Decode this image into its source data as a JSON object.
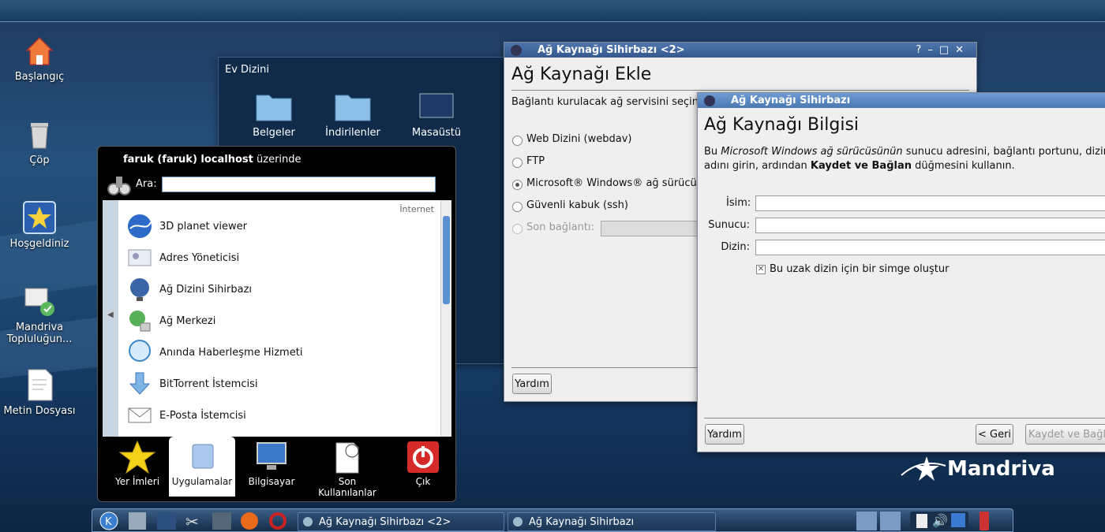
{
  "desktop": {
    "icons": [
      {
        "label": "Başlangıç",
        "icon": "home-icon"
      },
      {
        "label": "Çöp",
        "icon": "trash-icon"
      },
      {
        "label": "Hoşgeldiniz",
        "icon": "star-icon"
      },
      {
        "label": "Mandriva Topluluğun...",
        "icon": "mandriva-community-icon"
      },
      {
        "label": "Metin Dosyası",
        "icon": "text-file-icon"
      }
    ],
    "brand": "Mandriva"
  },
  "filemanager": {
    "title": "Ev Dizini",
    "folders": [
      "Belgeler",
      "İndirilenler",
      "Masaüstü"
    ]
  },
  "wizard1": {
    "title": "Ağ Kaynağı Sihirbazı <2>",
    "heading": "Ağ Kaynağı Ekle",
    "intro": "Bağlantı kurulacak ağ servisini seçin v",
    "options": [
      "Web Dizini (webdav)",
      "FTP",
      "Microsoft® Windows® ağ sürücüs",
      "Güvenli kabuk (ssh)",
      "Son bağlantı:"
    ],
    "selected_index": 2,
    "help": "Yardım"
  },
  "wizard2": {
    "title": "Ağ Kaynağı Sihirbazı",
    "heading": "Ağ Kaynağı Bilgisi",
    "desc_pre": "Bu ",
    "desc_em": "Microsoft Windows ağ sürücüsünün",
    "desc_mid": " sunucu adresini, bağlantı portunu, dizin",
    "desc_line2_pre": "adını girin, ardından ",
    "desc_bold": "Kaydet ve Bağlan",
    "desc_line2_post": " düğmesini kullanın.",
    "fields": [
      {
        "label": "İsim:",
        "value": ""
      },
      {
        "label": "Sunucu:",
        "value": ""
      },
      {
        "label": "Dizin:",
        "value": ""
      }
    ],
    "checkbox": "Bu uzak dizin için bir simge oluştur",
    "checkbox_checked": true,
    "help": "Yardım",
    "back": "< Geri",
    "save": "Kaydet ve Bağla"
  },
  "menu": {
    "user": "faruk (faruk) localhost",
    "user_suffix": " üzerinde",
    "search_label": "Ara:",
    "search_value": "",
    "category": "İnternet",
    "apps": [
      "3D planet viewer",
      "Adres Yöneticisi",
      "Ağ Dizini Sihirbazı",
      "Ağ Merkezi",
      "Anında Haberleşme Hizmeti",
      "BitTorrent İstemcisi",
      "E-Posta İstemcisi"
    ],
    "tabs": [
      "Yer İmleri",
      "Uygulamalar",
      "Bilgisayar",
      "Son Kullanılanlar",
      "Çık"
    ],
    "active_tab": 1
  },
  "taskbar": {
    "tasks": [
      "Ağ Kaynağı Sihirbazı <2>",
      "Ağ Kaynağı Sihirbazı"
    ]
  },
  "colors": {
    "accent": "#4a78b4",
    "desktop": "#1d4670"
  }
}
